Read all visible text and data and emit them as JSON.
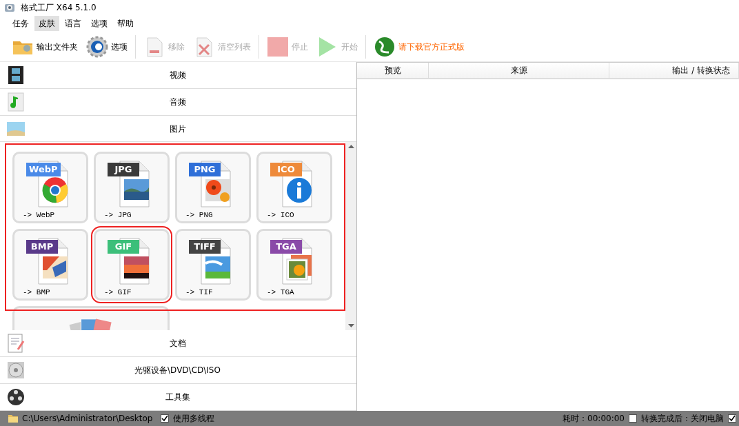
{
  "window": {
    "title": "格式工厂 X64 5.1.0"
  },
  "menu": [
    {
      "label": "任务",
      "selected": false
    },
    {
      "label": "皮肤",
      "selected": true
    },
    {
      "label": "语言",
      "selected": false
    },
    {
      "label": "选项",
      "selected": false
    },
    {
      "label": "帮助",
      "selected": false
    }
  ],
  "toolbar": [
    {
      "kind": "button",
      "label": "输出文件夹",
      "disabled": false
    },
    {
      "kind": "button",
      "label": "选项",
      "disabled": false
    },
    {
      "kind": "separator"
    },
    {
      "kind": "button",
      "label": "移除",
      "disabled": true
    },
    {
      "kind": "button",
      "label": "清空列表",
      "disabled": true
    },
    {
      "kind": "separator"
    },
    {
      "kind": "button",
      "label": "停止",
      "disabled": true
    },
    {
      "kind": "button",
      "label": "开始",
      "disabled": true
    },
    {
      "kind": "separator"
    },
    {
      "kind": "link",
      "label": "请下载官方正式版",
      "disabled": false
    }
  ],
  "categories": [
    {
      "label": "视频",
      "expanded": false
    },
    {
      "label": "音频",
      "expanded": false
    },
    {
      "label": "图片",
      "expanded": true
    },
    {
      "label": "文档",
      "expanded": false
    },
    {
      "label": "光驱设备\\DVD\\CD\\ISO",
      "expanded": false
    },
    {
      "label": "工具集",
      "expanded": false
    }
  ],
  "image_tools": {
    "highlighted": true,
    "tiles": [
      {
        "kind": "format",
        "badge": "WebP",
        "color": "#4a8ae8",
        "caption": "-> WebP",
        "highlighted": false
      },
      {
        "kind": "format",
        "badge": "JPG",
        "color": "#3a3a3a",
        "caption": "-> JPG",
        "highlighted": false
      },
      {
        "kind": "format",
        "badge": "PNG",
        "color": "#2f6fd8",
        "caption": "-> PNG",
        "highlighted": false
      },
      {
        "kind": "format",
        "badge": "ICO",
        "color": "#ee8a3a",
        "caption": "-> ICO",
        "highlighted": false
      },
      {
        "kind": "format",
        "badge": "BMP",
        "color": "#5a3a8a",
        "caption": "-> BMP",
        "highlighted": false
      },
      {
        "kind": "format",
        "badge": "GIF",
        "color": "#3cbf7a",
        "caption": "-> GIF",
        "highlighted": true
      },
      {
        "kind": "format",
        "badge": "TIFF",
        "color": "#444444",
        "caption": "-> TIF",
        "highlighted": false
      },
      {
        "kind": "format",
        "badge": "TGA",
        "color": "#8a4aa8",
        "caption": "-> TGA",
        "highlighted": false
      },
      {
        "kind": "partial"
      }
    ]
  },
  "table": {
    "columns": [
      "预览",
      "来源",
      "输出 / 转换状态"
    ]
  },
  "status_bar": {
    "path": "C:\\Users\\Administrator\\Desktop",
    "multithread": {
      "label": "使用多线程",
      "checked": true
    },
    "elapsed": "耗时：00:00:00",
    "after_done": {
      "label": "转换完成后：关闭电脑",
      "checked": false
    },
    "edge_checkbox": {
      "checked": true
    }
  }
}
